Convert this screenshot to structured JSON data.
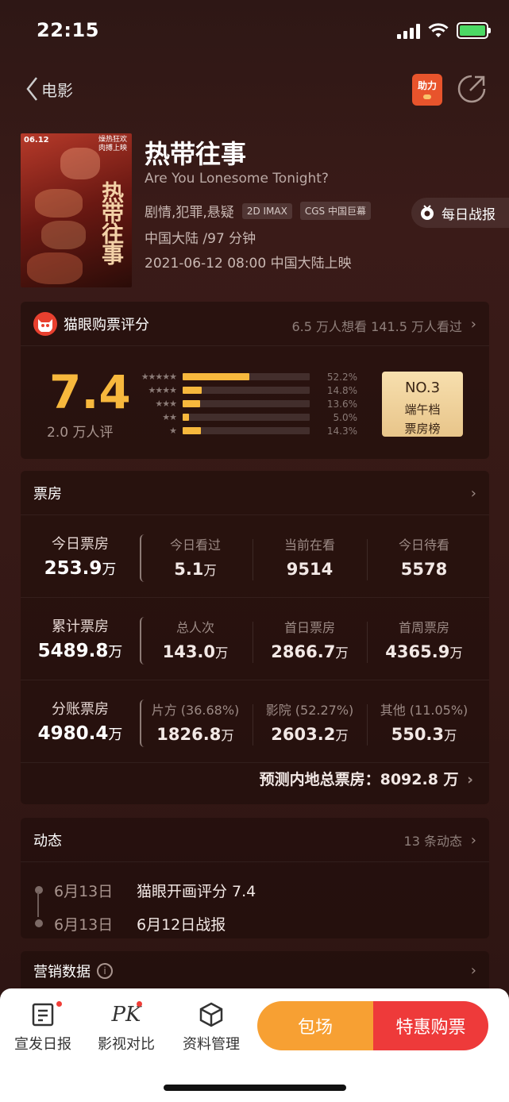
{
  "status": {
    "time": "22:15"
  },
  "nav": {
    "back_label": "电影",
    "helper_label": "助力"
  },
  "movie": {
    "title": "热带往事",
    "en_title": "Are You Lonesome Tonight?",
    "genres": "剧情,犯罪,悬疑",
    "tags": [
      "2D IMAX",
      "CGS 中国巨幕"
    ],
    "region_duration": "中国大陆 /97 分钟",
    "release": "2021-06-12 08:00 中国大陆上映",
    "daily_report": "每日战报",
    "poster": {
      "date": "06.12",
      "tag_line1": "燥热狂欢",
      "tag_line2": "肉搏上映",
      "title": "热带往事"
    }
  },
  "rating": {
    "header": "猫眼购票评分",
    "summary": "6.5 万人想看  141.5 万人看过",
    "score": "7.4",
    "count": "2.0 万人评",
    "distribution": [
      {
        "stars": "★★★★★",
        "pct": "52.2%",
        "value": 0.522
      },
      {
        "stars": "★★★★",
        "pct": "14.8%",
        "value": 0.148
      },
      {
        "stars": "★★★",
        "pct": "13.6%",
        "value": 0.136
      },
      {
        "stars": "★★",
        "pct": "5.0%",
        "value": 0.05
      },
      {
        "stars": "★",
        "pct": "14.3%",
        "value": 0.143
      }
    ],
    "rank": {
      "no": "NO.3",
      "line1": "端午档",
      "line2": "票房榜"
    }
  },
  "boxoffice": {
    "header": "票房",
    "rows": [
      {
        "main": {
          "label": "今日票房",
          "value": "253.9",
          "unit": "万"
        },
        "subs": [
          {
            "label": "今日看过",
            "value": "5.1",
            "unit": "万"
          },
          {
            "label": "当前在看",
            "value": "9514",
            "unit": ""
          },
          {
            "label": "今日待看",
            "value": "5578",
            "unit": ""
          }
        ]
      },
      {
        "main": {
          "label": "累计票房",
          "value": "5489.8",
          "unit": "万"
        },
        "subs": [
          {
            "label": "总人次",
            "value": "143.0",
            "unit": "万"
          },
          {
            "label": "首日票房",
            "value": "2866.7",
            "unit": "万"
          },
          {
            "label": "首周票房",
            "value": "4365.9",
            "unit": "万"
          }
        ]
      },
      {
        "main": {
          "label": "分账票房",
          "value": "4980.4",
          "unit": "万"
        },
        "subs": [
          {
            "label": "片方 (36.68%)",
            "value": "1826.8",
            "unit": "万"
          },
          {
            "label": "影院 (52.27%)",
            "value": "2603.2",
            "unit": "万"
          },
          {
            "label": "其他 (11.05%)",
            "value": "550.3",
            "unit": "万"
          }
        ]
      }
    ],
    "forecast": "预测内地总票房：8092.8 万"
  },
  "news": {
    "header": "动态",
    "count": "13 条动态",
    "items": [
      {
        "date": "6月13日",
        "text": "猫眼开画评分 7.4"
      },
      {
        "date": "6月13日",
        "text": "6月12日战报"
      }
    ]
  },
  "marketing": {
    "header": "营销数据"
  },
  "tabbar": {
    "items": [
      {
        "label": "宣发日报"
      },
      {
        "label": "影视对比"
      },
      {
        "label": "资料管理"
      }
    ],
    "pk_icon_text": "PK",
    "pack_label": "包场",
    "buy_label": "特惠购票"
  },
  "colors": {
    "accent": "#f7b83d",
    "buy": "#ee3a3a",
    "pack": "#f7a033"
  }
}
